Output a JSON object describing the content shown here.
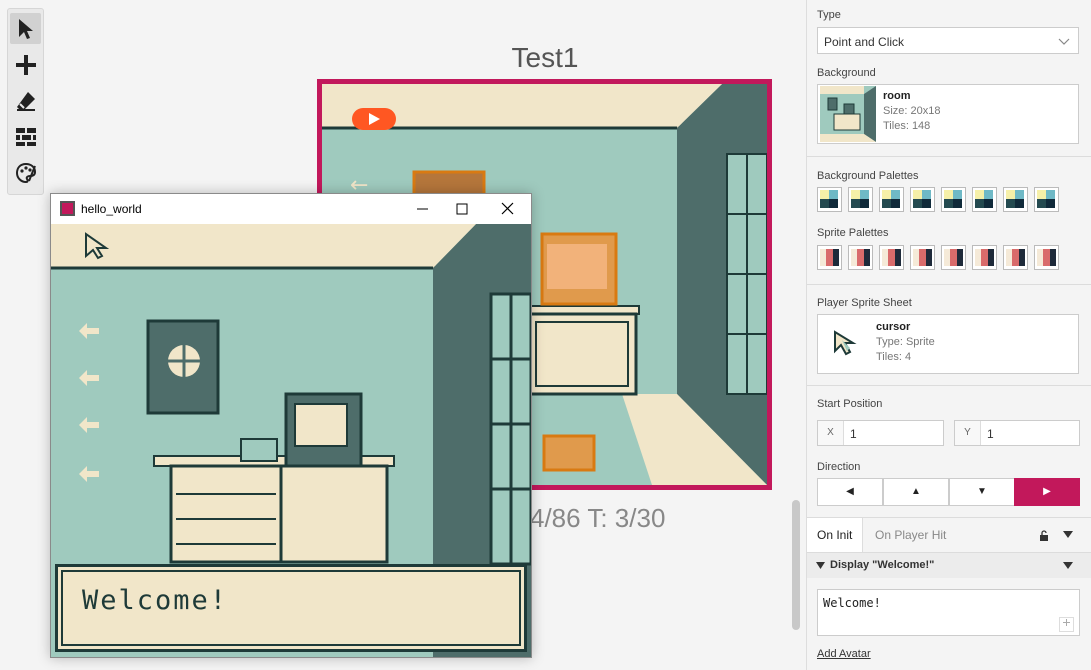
{
  "scene": {
    "title": "Test1",
    "counts": "4/86    T: 3/30"
  },
  "game_window": {
    "title": "hello_world",
    "dialog_text": "Welcome!"
  },
  "toolbar": {
    "tools": [
      "select-tool",
      "add-actor-tool",
      "eraser-tool",
      "collisions-tool",
      "colors-tool"
    ],
    "selected": "select-tool"
  },
  "sidebar": {
    "type_label": "Type",
    "type_value": "Point and Click",
    "background_label": "Background",
    "background": {
      "name": "room",
      "size_label": "Size:",
      "size": "20x18",
      "tiles_label": "Tiles:",
      "tiles": "148"
    },
    "bg_palettes_label": "Background Palettes",
    "sprite_palettes_label": "Sprite Palettes",
    "player_sprite_label": "Player Sprite Sheet",
    "player_sprite": {
      "name": "cursor",
      "type_label": "Type:",
      "type": "Sprite",
      "tiles_label": "Tiles:",
      "tiles": "4"
    },
    "start_position_label": "Start Position",
    "start_x_label": "X",
    "start_x": "1",
    "start_y_label": "Y",
    "start_y": "1",
    "direction_label": "Direction",
    "directions": [
      "◀",
      "▲",
      "▼",
      "▶"
    ],
    "selected_direction": "right",
    "tabs": [
      "On Init",
      "On Player Hit"
    ],
    "event_title": "Display \"Welcome!\"",
    "event_text": "Welcome!",
    "add_avatar": "Add Avatar"
  },
  "colors": {
    "accent": "#c2185b",
    "game_bg": "#9fcabe",
    "game_dark": "#1e3a38",
    "game_cream": "#f1e6c9"
  }
}
